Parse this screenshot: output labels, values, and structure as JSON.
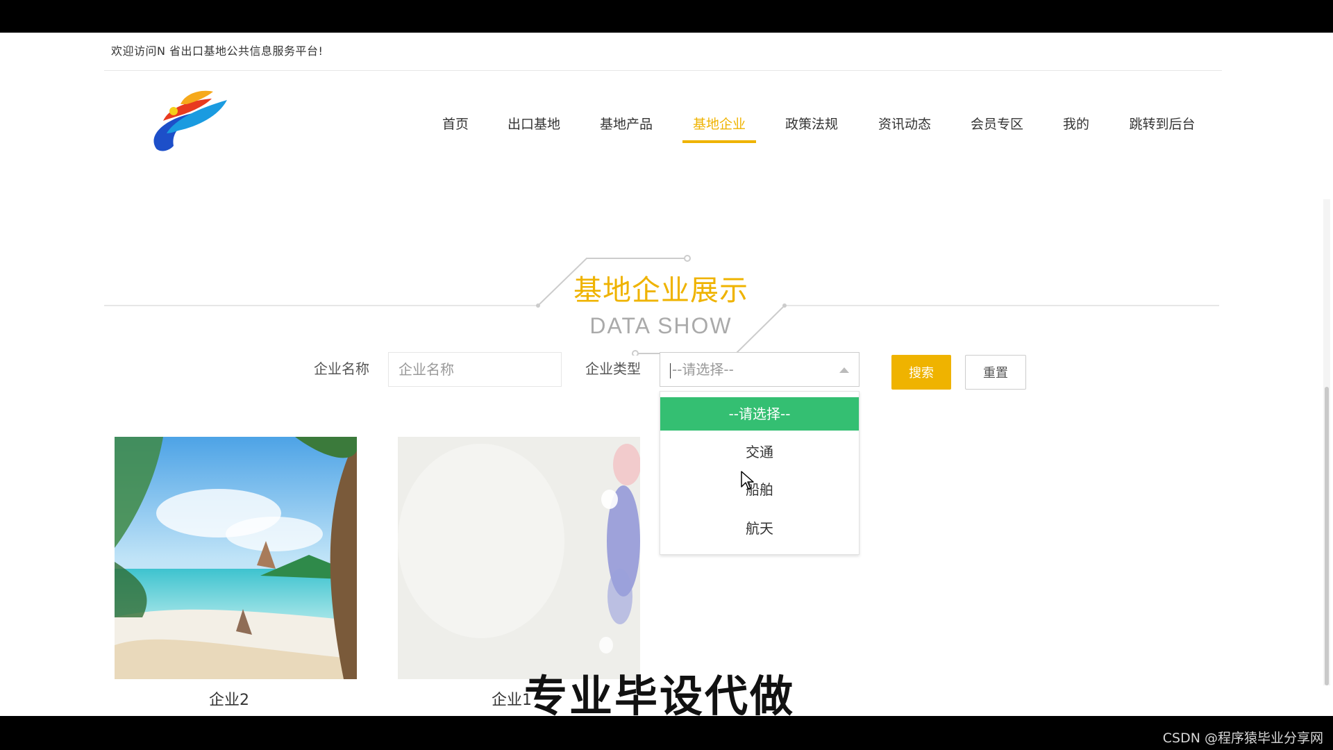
{
  "header": {
    "welcome": "欢迎访问N 省出口基地公共信息服务平台!"
  },
  "nav": {
    "items": [
      {
        "label": "首页"
      },
      {
        "label": "出口基地"
      },
      {
        "label": "基地产品"
      },
      {
        "label": "基地企业"
      },
      {
        "label": "政策法规"
      },
      {
        "label": "资讯动态"
      },
      {
        "label": "会员专区"
      },
      {
        "label": "我的"
      },
      {
        "label": "跳转到后台"
      }
    ],
    "active": "基地企业"
  },
  "section": {
    "title": "基地企业展示",
    "subtitle": "DATA SHOW"
  },
  "search": {
    "name_label": "企业名称",
    "name_placeholder": "企业名称",
    "type_label": "企业类型",
    "type_value": "--请选择--",
    "search_button": "搜索",
    "reset_button": "重置"
  },
  "dropdown": {
    "options": [
      "--请选择--",
      "交通",
      "船舶",
      "航天"
    ],
    "selected": "--请选择--"
  },
  "cards": [
    {
      "name": "企业2"
    },
    {
      "name": "企业1"
    }
  ],
  "overlay": "专业毕设代做",
  "footer": {
    "credit": "CSDN @程序猿毕业分享网"
  },
  "colors": {
    "accent": "#efb300",
    "selected_option": "#34bf72"
  }
}
